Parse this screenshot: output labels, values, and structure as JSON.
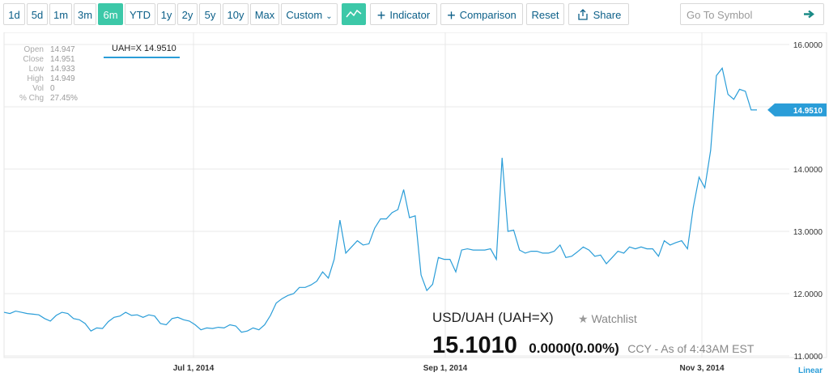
{
  "toolbar": {
    "ranges": [
      "1d",
      "5d",
      "1m",
      "3m",
      "6m",
      "YTD",
      "1y",
      "2y",
      "5y",
      "10y",
      "Max"
    ],
    "active_range": "6m",
    "custom_label": "Custom",
    "indicator_label": "Indicator",
    "comparison_label": "Comparison",
    "reset_label": "Reset",
    "share_label": "Share",
    "search_placeholder": "Go To Symbol"
  },
  "ohlc": [
    {
      "label": "Open",
      "value": "14.947"
    },
    {
      "label": "Close",
      "value": "14.951"
    },
    {
      "label": "Low",
      "value": "14.933"
    },
    {
      "label": "High",
      "value": "14.949"
    },
    {
      "label": "Vol",
      "value": "0"
    },
    {
      "label": "% Chg",
      "value": "27.45%"
    }
  ],
  "series_tag": "UAH=X 14.9510",
  "quote": {
    "name": "USD/UAH (UAH=X)",
    "watchlist": "Watchlist",
    "price": "15.1010",
    "change": "0.0000",
    "change_pct": "(0.00%)",
    "note": "CCY - As of 4:43AM EST"
  },
  "scale_label": "Linear",
  "colors": {
    "accent": "#3cc8a8",
    "line": "#2a9dd8",
    "link": "#0b5f88"
  },
  "chart_data": {
    "type": "line",
    "ylim": [
      11,
      16
    ],
    "y_ticks": [
      "16.0000",
      "15.0000",
      "14.0000",
      "13.0000",
      "12.0000",
      "11.0000"
    ],
    "x_tick_labels": [
      "Jul 1, 2014",
      "Sep 1, 2014",
      "Nov 3, 2014"
    ],
    "last_value_label": "14.9510",
    "series": [
      {
        "values": [
          11.7,
          11.68,
          11.72,
          11.7,
          11.68,
          11.67,
          11.66,
          11.6,
          11.56,
          11.65,
          11.7,
          11.68,
          11.6,
          11.58,
          11.52,
          11.4,
          11.45,
          11.44,
          11.55,
          11.62,
          11.64,
          11.7,
          11.65,
          11.66,
          11.62,
          11.66,
          11.64,
          11.52,
          11.5,
          11.6,
          11.62,
          11.58,
          11.56,
          11.5,
          11.42,
          11.45,
          11.44,
          11.46,
          11.45,
          11.5,
          11.48,
          11.38,
          11.4,
          11.45,
          11.42,
          11.5,
          11.65,
          11.85,
          11.92,
          11.97,
          12.0,
          12.1,
          12.1,
          12.14,
          12.2,
          12.35,
          12.25,
          12.55,
          13.18,
          12.65,
          12.75,
          12.85,
          12.78,
          12.8,
          13.05,
          13.2,
          13.2,
          13.3,
          13.35,
          13.67,
          13.22,
          13.25,
          12.3,
          12.05,
          12.15,
          12.58,
          12.55,
          12.55,
          12.35,
          12.7,
          12.72,
          12.7,
          12.7,
          12.7,
          12.72,
          12.55,
          14.18,
          13.0,
          13.02,
          12.7,
          12.65,
          12.68,
          12.68,
          12.65,
          12.65,
          12.68,
          12.78,
          12.58,
          12.6,
          12.67,
          12.75,
          12.7,
          12.6,
          12.62,
          12.48,
          12.58,
          12.68,
          12.65,
          12.75,
          12.72,
          12.75,
          12.72,
          12.72,
          12.6,
          12.85,
          12.78,
          12.82,
          12.85,
          12.72,
          13.38,
          13.87,
          13.7,
          14.3,
          15.5,
          15.62,
          15.2,
          15.12,
          15.28,
          15.25,
          14.95,
          14.95
        ]
      }
    ]
  }
}
